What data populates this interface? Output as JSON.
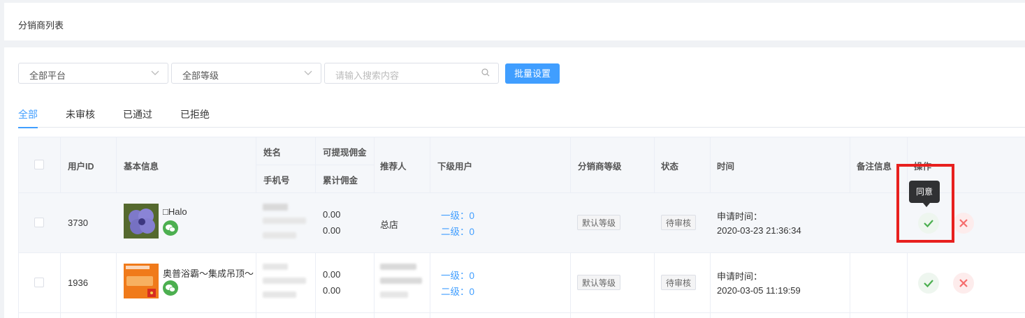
{
  "page": {
    "title": "分销商列表"
  },
  "filters": {
    "platform": "全部平台",
    "level": "全部等级",
    "search_placeholder": "请输入搜索内容",
    "batch_button": "批量设置"
  },
  "tabs": [
    {
      "label": "全部",
      "active": true
    },
    {
      "label": "未审核",
      "active": false
    },
    {
      "label": "已通过",
      "active": false
    },
    {
      "label": "已拒绝",
      "active": false
    }
  ],
  "table": {
    "headers": {
      "user_id": "用户ID",
      "basic_info": "基本信息",
      "name": "姓名",
      "phone": "手机号",
      "withdrawable": "可提现佣金",
      "total": "累计佣金",
      "referrer": "推荐人",
      "subordinates": "下级用户",
      "level": "分销商等级",
      "status": "状态",
      "time": "时间",
      "remark": "备注信息",
      "actions": "操作"
    },
    "rows": [
      {
        "user_id": "3730",
        "nickname": "□Halo",
        "withdrawable": "0.00",
        "total": "0.00",
        "referrer": "总店",
        "level1": "一级：0",
        "level2": "二级：0",
        "level_tag": "默认等级",
        "status_tag": "待审核",
        "time_label": "申请时间：",
        "time_value": "2020-03-23 21:36:34"
      },
      {
        "user_id": "1936",
        "nickname": "奥普浴霸～集成吊顶～",
        "withdrawable": "0.00",
        "total": "0.00",
        "referrer": "",
        "level1": "一级：0",
        "level2": "二级：0",
        "level_tag": "默认等级",
        "status_tag": "待审核",
        "time_label": "申请时间：",
        "time_value": "2020-03-05 11:19:59"
      }
    ]
  },
  "tooltip": {
    "text": "同意"
  },
  "colors": {
    "primary": "#409eff",
    "highlight": "#e8201e",
    "approve": "#4caf50",
    "reject": "#f56c6c"
  }
}
